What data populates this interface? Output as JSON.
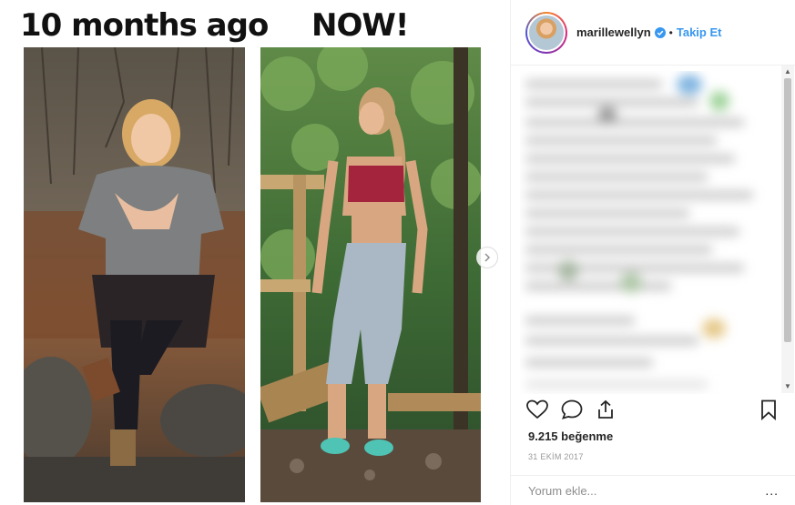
{
  "post": {
    "caption_left": "10 months ago",
    "caption_right": "NOW!"
  },
  "header": {
    "username": "marillewellyn",
    "separator": "•",
    "follow_label": "Takip Et"
  },
  "footer": {
    "likes": "9.215 beğenme",
    "date": "31 EKİM 2017",
    "comment_placeholder": "Yorum ekle...",
    "more_label": "..."
  },
  "colors": {
    "accent": "#3897f0",
    "text": "#262626",
    "muted": "#8e8e8e"
  },
  "icons": [
    "verified-badge-icon",
    "heart-icon",
    "comment-icon",
    "share-icon",
    "bookmark-icon",
    "chevron-right-icon"
  ]
}
